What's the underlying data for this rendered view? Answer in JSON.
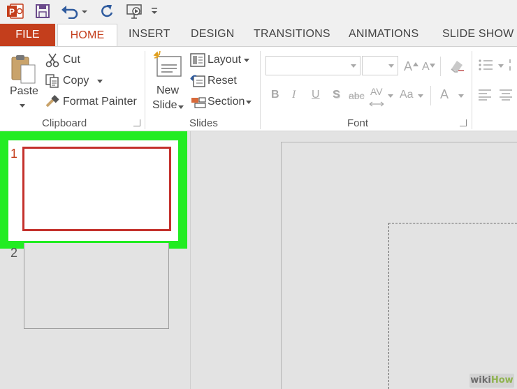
{
  "tabs": {
    "file": "FILE",
    "home": "HOME",
    "insert": "INSERT",
    "design": "DESIGN",
    "transitions": "TRANSITIONS",
    "animations": "ANIMATIONS",
    "slideshow": "SLIDE SHOW"
  },
  "clipboard": {
    "paste": "Paste",
    "cut": "Cut",
    "copy": "Copy",
    "format_painter": "Format Painter",
    "group_label": "Clipboard"
  },
  "slides": {
    "new_slide_line1": "New",
    "new_slide_line2": "Slide",
    "layout": "Layout",
    "reset": "Reset",
    "section": "Section",
    "group_label": "Slides"
  },
  "font": {
    "bold": "B",
    "italic": "I",
    "underline": "U",
    "shadow": "S",
    "strikethrough": "abc",
    "spacing": "AV",
    "change_case": "Aa",
    "font_color": "A",
    "grow": "A",
    "shrink": "A",
    "group_label": "Font"
  },
  "thumbnails": [
    {
      "number": "1"
    },
    {
      "number": "2"
    }
  ],
  "watermark": {
    "part1": "wiki",
    "part2": "How"
  },
  "colors": {
    "accent": "#c43e1c",
    "highlight": "#22ec22",
    "slide_border": "#c4312c"
  }
}
